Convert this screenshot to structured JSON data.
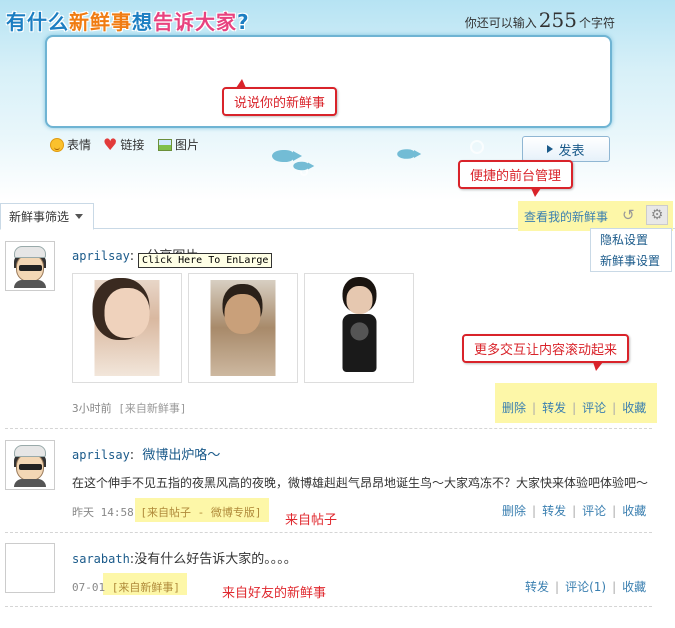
{
  "composer": {
    "headline": [
      "有什么",
      "新鲜事",
      "想",
      "告诉大家",
      "?"
    ],
    "counter_prefix": "你还可以输入",
    "counter_value": "255",
    "counter_suffix": "个字符",
    "toolbar": [
      {
        "label": "表情",
        "icon": "smile-icon"
      },
      {
        "label": "链接",
        "icon": "heart-icon"
      },
      {
        "label": "图片",
        "icon": "picture-icon"
      }
    ],
    "post_button": "发表"
  },
  "callouts": {
    "compose": "说说你的新鲜事",
    "frontend": "便捷的前台管理",
    "interact": "更多交互让内容滚动起来",
    "from_post": "来自帖子",
    "from_friend": "来自好友的新鲜事"
  },
  "filter": {
    "tab_label": "新鲜事筛选",
    "view_my": "查看我的新鲜事",
    "menu": [
      "隐私设置",
      "新鲜事设置"
    ]
  },
  "feed": [
    {
      "user": "aprilsay",
      "text": "分享图片",
      "tooltip": "Click Here To EnLarge",
      "time": "3小时前",
      "source": "[来自新鲜事]",
      "actions": [
        "删除",
        "转发",
        "评论",
        "收藏"
      ]
    },
    {
      "user": "aprilsay",
      "text": "微博出炉咯～",
      "body": "在这个伸手不见五指的夜黑风高的夜晚，微博雄赳赳气昂昂地诞生鸟～大家鸡冻不？大家快来体验吧体验吧～",
      "time": "昨天 14:58",
      "source": "[来自帖子 - 微博专版]",
      "actions": [
        "删除",
        "转发",
        "评论",
        "收藏"
      ]
    },
    {
      "user": "sarabath",
      "text": "没有什么好告诉大家的。。。。",
      "time": "07-01",
      "source": "[来自新鲜事]",
      "actions": [
        "转发",
        "评论(1)",
        "收藏"
      ]
    }
  ],
  "colors": {
    "accent_blue": "#1a5a8a",
    "callout_red": "#d9232a",
    "highlight_yellow": "#fdf7a8"
  }
}
